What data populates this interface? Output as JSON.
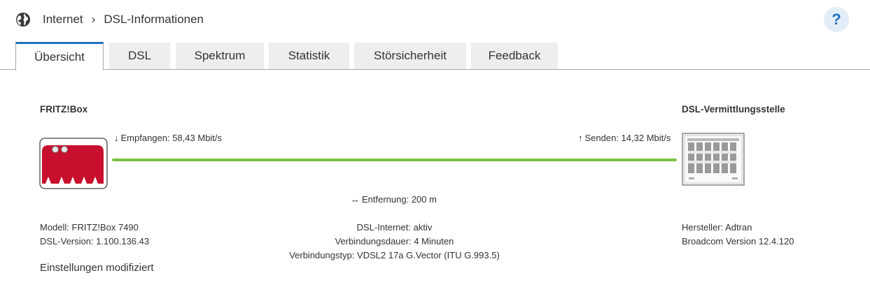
{
  "breadcrumb": {
    "items": [
      "Internet",
      "DSL-Informationen"
    ]
  },
  "help_label": "?",
  "tabs": [
    {
      "label": "Übersicht",
      "active": true
    },
    {
      "label": "DSL",
      "active": false
    },
    {
      "label": "Spektrum",
      "active": false
    },
    {
      "label": "Statistik",
      "active": false
    },
    {
      "label": "Störsicherheit",
      "active": false
    },
    {
      "label": "Feedback",
      "active": false
    }
  ],
  "overview": {
    "fritzbox_title": "FRITZ!Box",
    "exchange_title": "DSL-Vermittlungsstelle",
    "downstream": "Empfangen: 58,43 Mbit/s",
    "upstream": "Senden: 14,32 Mbit/s",
    "distance": "Entfernung: 200 m",
    "link_color": "#7dc242",
    "left_info": [
      "Modell: FRITZ!Box 7490",
      "DSL-Version: 1.100.136.43"
    ],
    "center_info": [
      "DSL-Internet: aktiv",
      "Verbindungsdauer: 4 Minuten",
      "Verbindungstyp: VDSL2 17a G.Vector (ITU G.993.5)"
    ],
    "right_info": [
      "Hersteller: Adtran",
      "Broadcom Version 12.4.120"
    ],
    "settings_link": "Einstellungen modifiziert"
  },
  "colors": {
    "accent": "#1e73be",
    "help_bg": "#e3edf7",
    "fritzbox_red": "#c8102e"
  },
  "icons": {
    "breadcrumb": "globe-icon",
    "down": "arrow-down-icon",
    "up": "arrow-up-icon",
    "distance": "double-arrow-icon"
  }
}
